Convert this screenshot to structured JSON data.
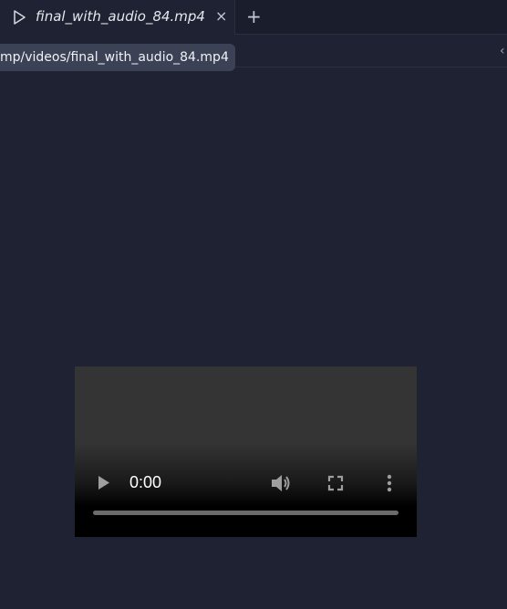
{
  "tab": {
    "title": "final_with_audio_84.mp4",
    "close_glyph": "×",
    "new_tab_glyph": "+"
  },
  "path_tooltip": {
    "text": "mp/videos/final_with_audio_84.mp4"
  },
  "collapse_glyph": "‹",
  "video_controls": {
    "current_time": "0:00",
    "progress_fraction": 0
  },
  "colors": {
    "background": "#1e2233",
    "tab_bar": "#1a1e2c",
    "tooltip": "#3b4256"
  }
}
